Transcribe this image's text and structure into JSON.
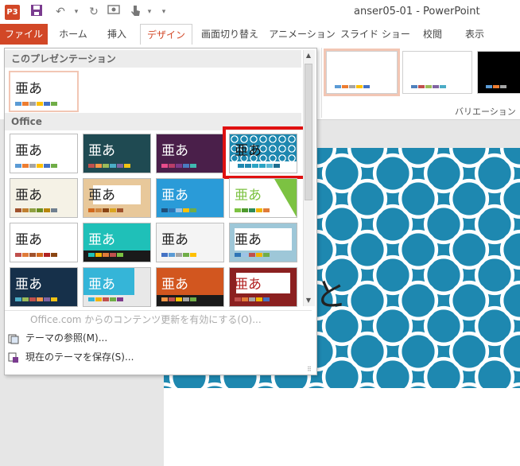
{
  "window": {
    "title": "anser05-01 - PowerPoint",
    "app_badge": "P3"
  },
  "qat": {
    "save_icon": "save-icon",
    "undo_icon": "undo-icon",
    "redo_icon": "redo-icon"
  },
  "tabs": [
    "ファイル",
    "ホーム",
    "挿入",
    "デザイン",
    "画面切り替え",
    "アニメーション",
    "スライド ショー",
    "校閲",
    "表示"
  ],
  "ribbon": {
    "variation_label": "バリエーション"
  },
  "gallery": {
    "section_current": "このプレゼンテーション",
    "section_office": "Office",
    "theme_sample_text": "亜あ",
    "menu": {
      "office_update": "Office.com からのコンテンツ更新を有効にする(O)...",
      "browse": "テーマの参照(M)...",
      "save": "現在のテーマを保存(S)..."
    }
  },
  "slide": {
    "title_fragment": "タバコと"
  },
  "colors": {
    "accent": "#d24726",
    "highlight": "#e01010",
    "slide_blue": "#1e88b0"
  }
}
